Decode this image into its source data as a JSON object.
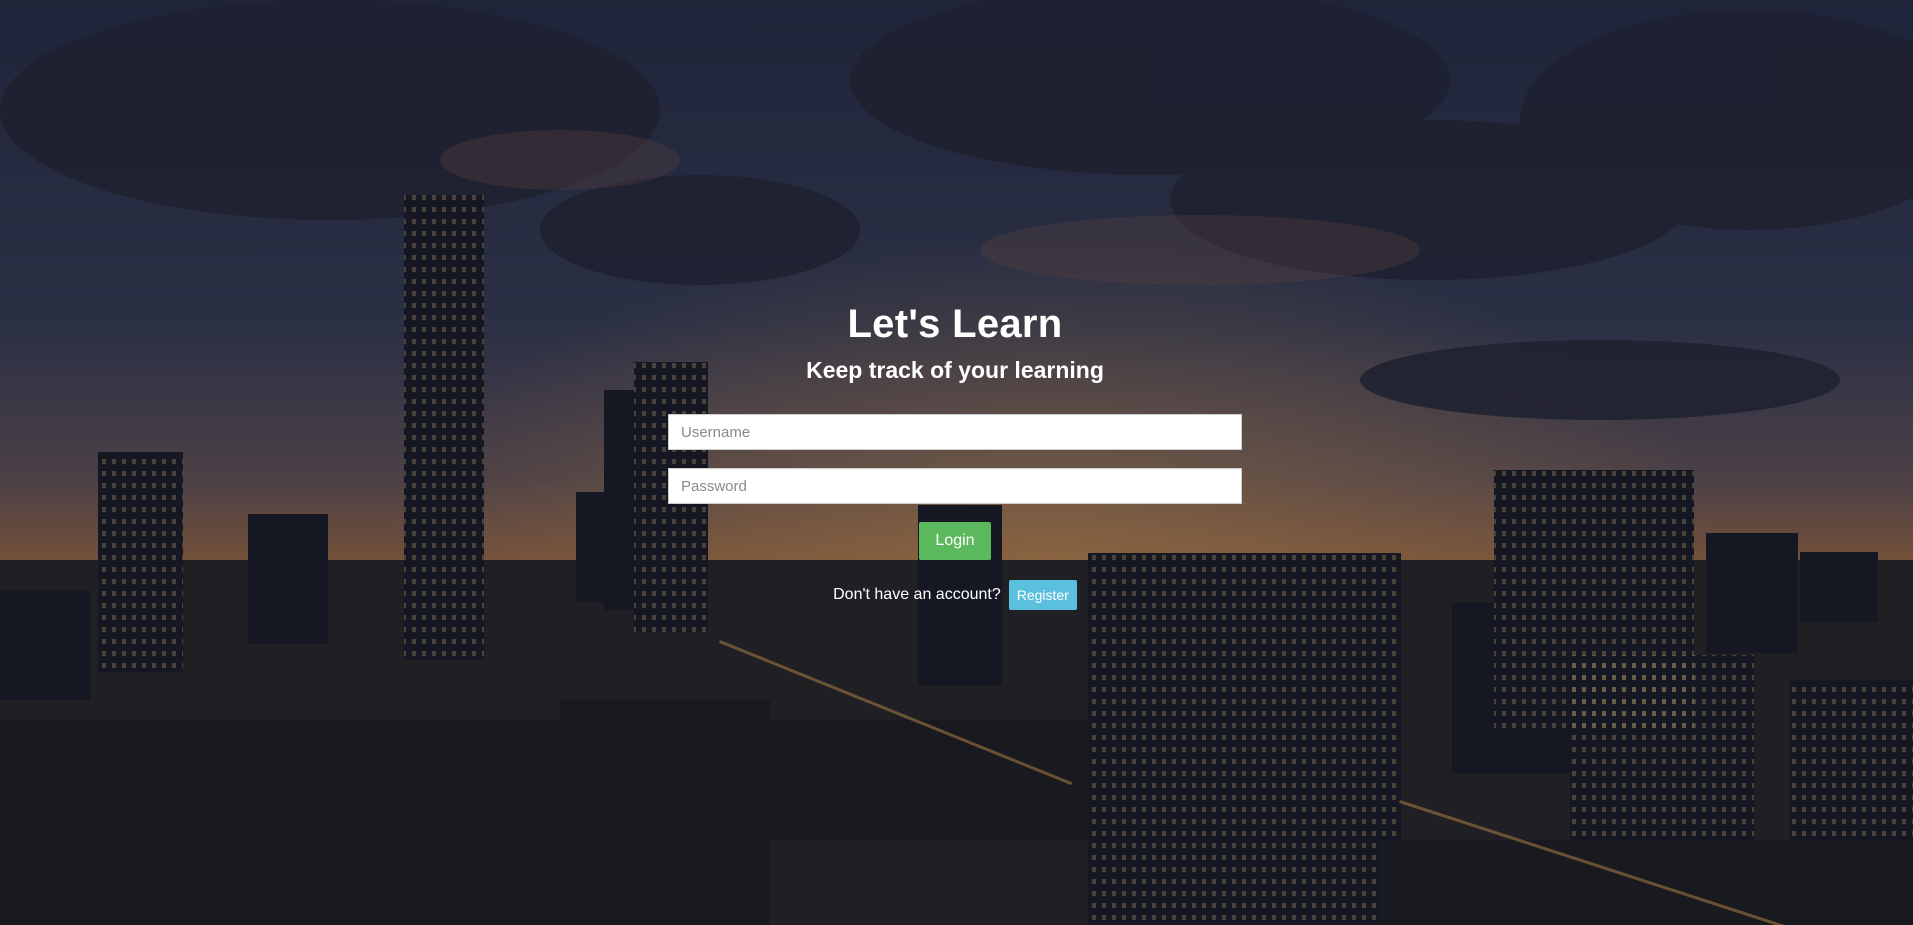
{
  "hero": {
    "title": "Let's Learn",
    "tagline": "Keep track of your learning"
  },
  "login_form": {
    "username_placeholder": "Username",
    "username_value": "",
    "password_placeholder": "Password",
    "password_value": "",
    "login_label": "Login"
  },
  "register": {
    "prompt": "Don't have an account?",
    "button_label": "Register"
  },
  "colors": {
    "login_button": "#5cb85c",
    "register_button": "#5bc0de",
    "text": "#ffffff"
  }
}
